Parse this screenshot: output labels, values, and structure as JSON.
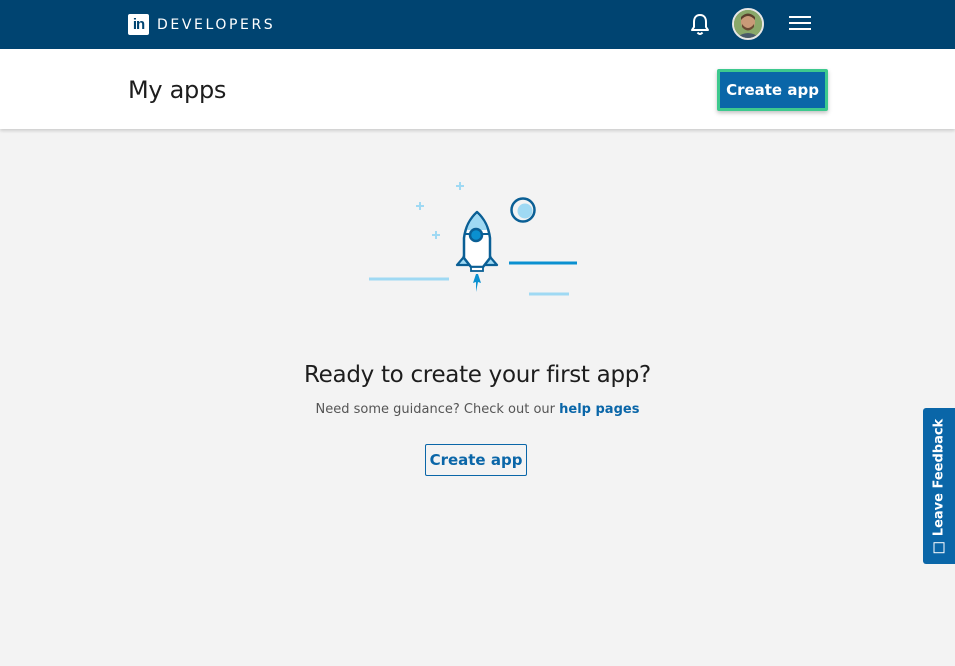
{
  "topbar": {
    "brand_logo": "in",
    "brand_text": "DEVELOPERS",
    "icons": [
      "bell-icon",
      "avatar",
      "hamburger-menu-icon"
    ]
  },
  "header": {
    "title": "My apps",
    "create_button": "Create app"
  },
  "empty_state": {
    "title": "Ready to create your first app?",
    "subtitle": "Need some guidance? Check out our",
    "help_link": "help pages",
    "create_button": "Create app"
  },
  "feedback": {
    "label": "Leave Feedback"
  },
  "colors": {
    "topbar": "#004471",
    "primary": "#0a66a8",
    "focus_ring": "#3dc98e",
    "background": "#f3f3f3"
  }
}
